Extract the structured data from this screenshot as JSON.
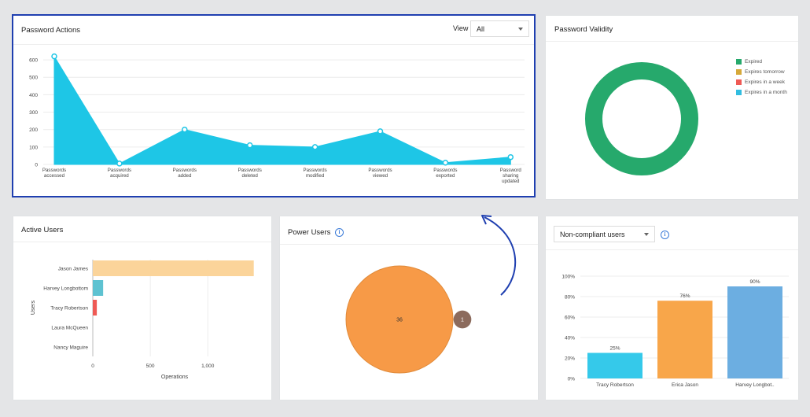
{
  "password_actions": {
    "title": "Password Actions",
    "view_label": "View",
    "view_value": "All",
    "chart_data": {
      "type": "area",
      "categories": [
        [
          "Passwords",
          "accessed"
        ],
        [
          "Passwords",
          "acquired"
        ],
        [
          "Passwords",
          "added"
        ],
        [
          "Passwords",
          "deleted"
        ],
        [
          "Passwords",
          "modified"
        ],
        [
          "Passwords",
          "viewed"
        ],
        [
          "Passwords",
          "exported"
        ],
        [
          "Password",
          "sharing",
          "updated"
        ]
      ],
      "values": [
        620,
        5,
        200,
        110,
        100,
        190,
        10,
        42
      ],
      "y_ticks": [
        "0",
        "100",
        "200",
        "300",
        "400",
        "500",
        "600"
      ],
      "ylim": [
        0,
        650
      ],
      "color": "#1ec6e6"
    }
  },
  "password_validity": {
    "title": "Password Validity",
    "chart_data": {
      "type": "pie",
      "legend": [
        {
          "label": "Expired",
          "color": "#26a96c"
        },
        {
          "label": "Expires tomorrow",
          "color": "#d6a93a"
        },
        {
          "label": "Expires in a week",
          "color": "#ef5a55"
        },
        {
          "label": "Expires in a month",
          "color": "#32bde0"
        }
      ],
      "values": [
        100,
        0,
        0,
        0
      ]
    }
  },
  "active_users": {
    "title": "Active Users",
    "chart_data": {
      "type": "bar",
      "categories": [
        "Jason James",
        "Harvey Longbottom",
        "Tracy Robertson",
        "Laura McQueen",
        "Nancy Maguire"
      ],
      "values": [
        1400,
        90,
        35,
        0,
        0
      ],
      "colors": [
        "#fbd49a",
        "#5ec2d1",
        "#ef5a55",
        "#cccccc",
        "#cccccc"
      ],
      "x_ticks": [
        {
          "value": 0,
          "label": "0"
        },
        {
          "value": 500,
          "label": "500"
        },
        {
          "value": 1000,
          "label": "1,000"
        }
      ],
      "xlim": [
        0,
        1450
      ],
      "xlabel": "Operations",
      "ylabel": "Users"
    }
  },
  "power_users": {
    "title": "Power Users",
    "chart_data": {
      "type": "bubble",
      "values": [
        {
          "value": 36,
          "label": "36",
          "color": "#f79a47"
        },
        {
          "value": 1,
          "label": "1",
          "color": "#8c6b5d"
        }
      ]
    }
  },
  "non_compliant": {
    "select_value": "Non-compliant users",
    "chart_data": {
      "type": "bar",
      "categories": [
        "Tracy Robertson",
        "Erica Jason",
        "Harvey Longbot.."
      ],
      "values": [
        25,
        76,
        90
      ],
      "value_labels": [
        "25%",
        "76%",
        "90%"
      ],
      "colors": [
        "#35c9ea",
        "#f8a64a",
        "#6caee1"
      ],
      "y_ticks": [
        "0%",
        "20%",
        "40%",
        "60%",
        "80%",
        "100%"
      ],
      "ylim": [
        0,
        100
      ]
    }
  }
}
